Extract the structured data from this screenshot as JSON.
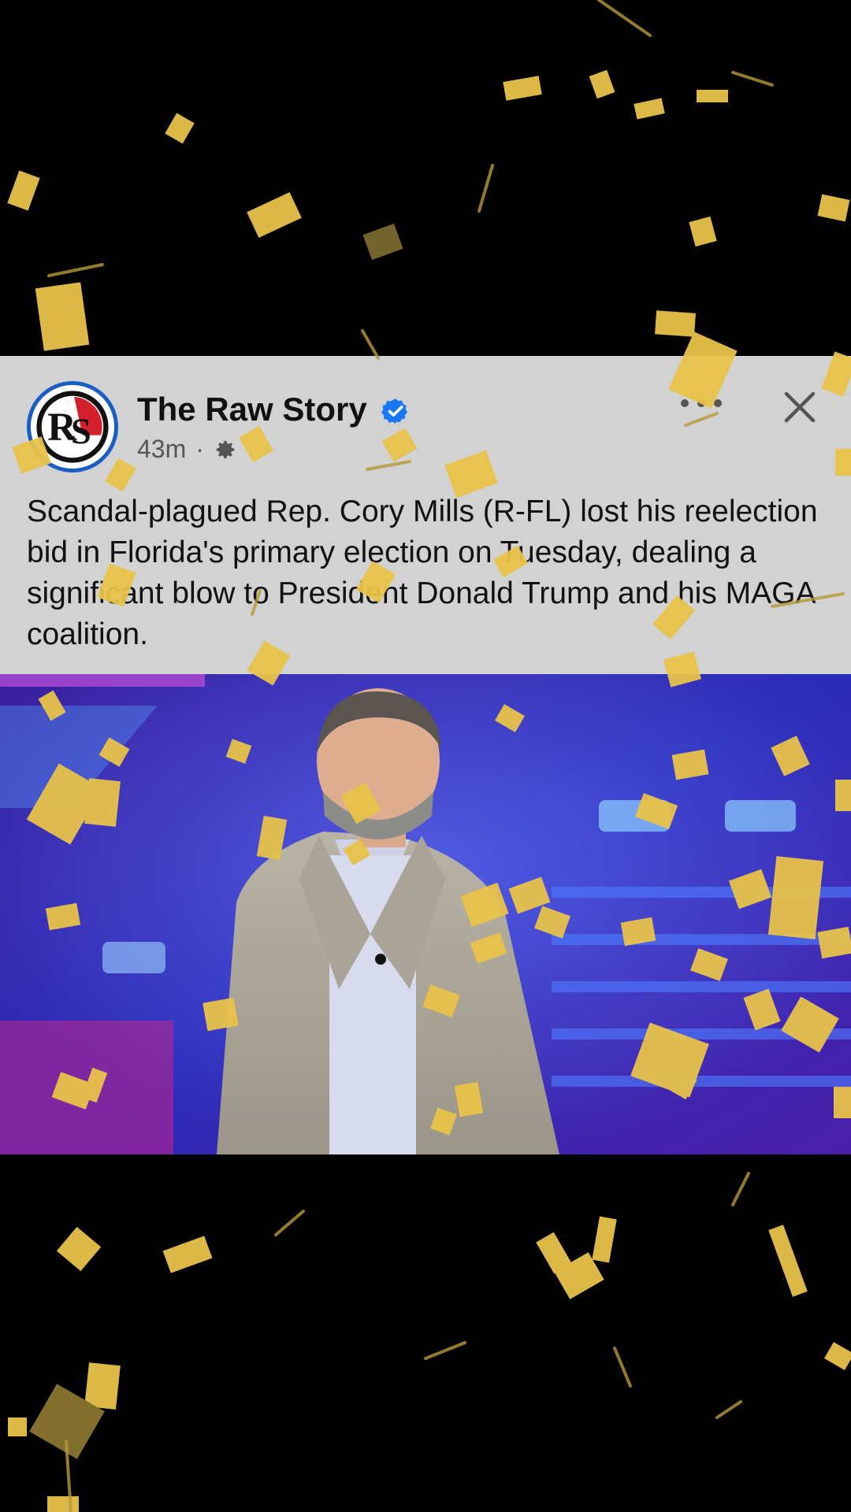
{
  "post": {
    "page_name": "The Raw Story",
    "avatar_text": "RS",
    "timestamp": "43m",
    "meta_separator": "·",
    "audience_icon": "gear-icon",
    "verified_icon": "verified-badge-icon",
    "more_icon": "more-options-icon",
    "close_icon": "close-icon",
    "text": "Scandal-plagued Rep. Cory Mills (R-FL) lost his reelection bid in Florida's primary election on Tuesday, dealing a significant blow to President Donald Trump and his MAGA coalition."
  },
  "colors": {
    "card_background": "#d2d2d2",
    "verified_blue": "#1877f2",
    "confetti_gold": "#e8c24a",
    "screen_background": "#000000"
  }
}
